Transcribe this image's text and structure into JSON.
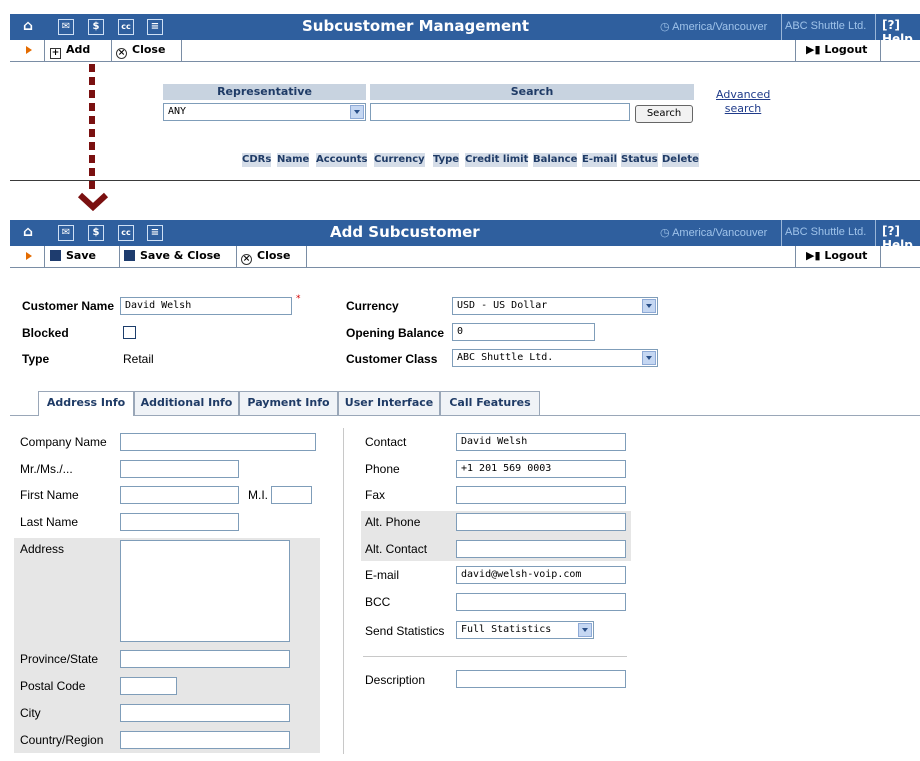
{
  "top": {
    "title": "Subcustomer Management",
    "timezone": "America/Vancouver",
    "company": "ABC Shuttle Ltd.",
    "help": "Help",
    "toolbar": {
      "add": "Add",
      "close": "Close",
      "logout": "Logout"
    },
    "search_panel": {
      "representative_header": "Representative",
      "search_header": "Search",
      "representative_value": "ANY",
      "search_value": "",
      "search_button": "Search",
      "advanced_search_line1": "Advanced",
      "advanced_search_line2": "search"
    },
    "columns": [
      "CDRs",
      "Name",
      "Accounts",
      "Currency",
      "Type",
      "Credit limit",
      "Balance",
      "E-mail",
      "Status",
      "Delete"
    ]
  },
  "bottom": {
    "title": "Add Subcustomer",
    "timezone": "America/Vancouver",
    "company": "ABC Shuttle Ltd.",
    "help": "Help",
    "toolbar": {
      "save": "Save",
      "save_close": "Save & Close",
      "close": "Close",
      "logout": "Logout"
    },
    "form": {
      "customer_name_label": "Customer Name",
      "customer_name_value": "David Welsh",
      "required_mark": "*",
      "blocked_label": "Blocked",
      "blocked_checked": false,
      "type_label": "Type",
      "type_value": "Retail",
      "currency_label": "Currency",
      "currency_value": "USD - US Dollar",
      "opening_balance_label": "Opening Balance",
      "opening_balance_value": "0",
      "customer_class_label": "Customer Class",
      "customer_class_value": "ABC Shuttle Ltd."
    },
    "tabs": [
      "Address Info",
      "Additional Info",
      "Payment Info",
      "User Interface",
      "Call Features"
    ],
    "active_tab": "Address Info",
    "address": {
      "company_name_label": "Company Name",
      "company_name_value": "",
      "salutation_label": "Mr./Ms./...",
      "salutation_value": "",
      "first_name_label": "First Name",
      "first_name_value": "",
      "mi_label": "M.I.",
      "mi_value": "",
      "last_name_label": "Last Name",
      "last_name_value": "",
      "address_label": "Address",
      "address_value": "",
      "province_label": "Province/State",
      "province_value": "",
      "postal_label": "Postal Code",
      "postal_value": "",
      "city_label": "City",
      "city_value": "",
      "country_label": "Country/Region",
      "country_value": ""
    },
    "contact": {
      "contact_label": "Contact",
      "contact_value": "David Welsh",
      "phone_label": "Phone",
      "phone_value": "+1 201 569 0003",
      "fax_label": "Fax",
      "fax_value": "",
      "alt_phone_label": "Alt. Phone",
      "alt_phone_value": "",
      "alt_contact_label": "Alt. Contact",
      "alt_contact_value": "",
      "email_label": "E-mail",
      "email_value": "david@welsh-voip.com",
      "bcc_label": "BCC",
      "bcc_value": "",
      "send_stats_label": "Send Statistics",
      "send_stats_value": "Full Statistics",
      "description_label": "Description",
      "description_value": ""
    }
  },
  "colors": {
    "titlebar": "#2f5f9e",
    "timezone_text": "#9fc3ea",
    "header_cell": "#c8d3e0",
    "arrow": "#7a1010",
    "toolbar_play": "#e46b00"
  }
}
